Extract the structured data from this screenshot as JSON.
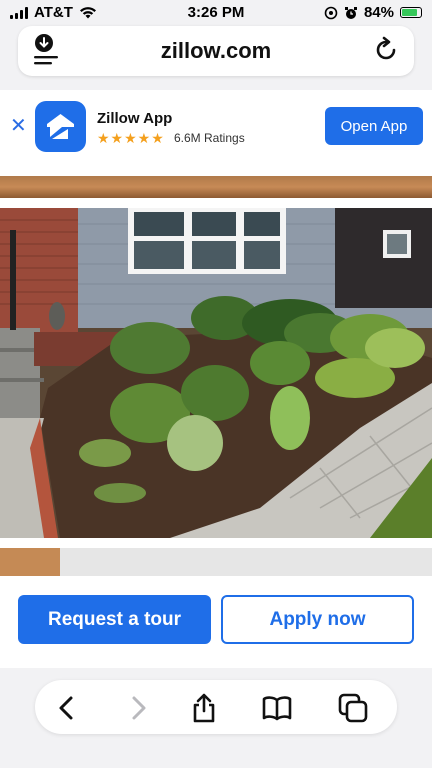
{
  "status_bar": {
    "carrier": "AT&T",
    "time": "3:26 PM",
    "battery_percent": "84%",
    "battery_level": 0.84,
    "icons": [
      "signal-icon",
      "wifi-icon",
      "location-icon",
      "alarm-icon",
      "battery-charging-icon"
    ]
  },
  "address_bar": {
    "domain": "zillow.com",
    "icons": [
      "download-menu-icon",
      "reload-icon"
    ]
  },
  "app_banner": {
    "close_symbol": "✕",
    "app_name": "Zillow App",
    "stars": "★★★★★",
    "ratings": "6.6M Ratings",
    "open_label": "Open App",
    "brand_color": "#1f6ee8"
  },
  "photo": {
    "subject": "front-yard-garden-photo"
  },
  "actions": {
    "tour_label": "Request a tour",
    "apply_label": "Apply now"
  },
  "toolbar": {
    "icons": [
      "back-icon",
      "forward-icon",
      "share-icon",
      "bookmarks-icon",
      "tabs-icon"
    ]
  }
}
